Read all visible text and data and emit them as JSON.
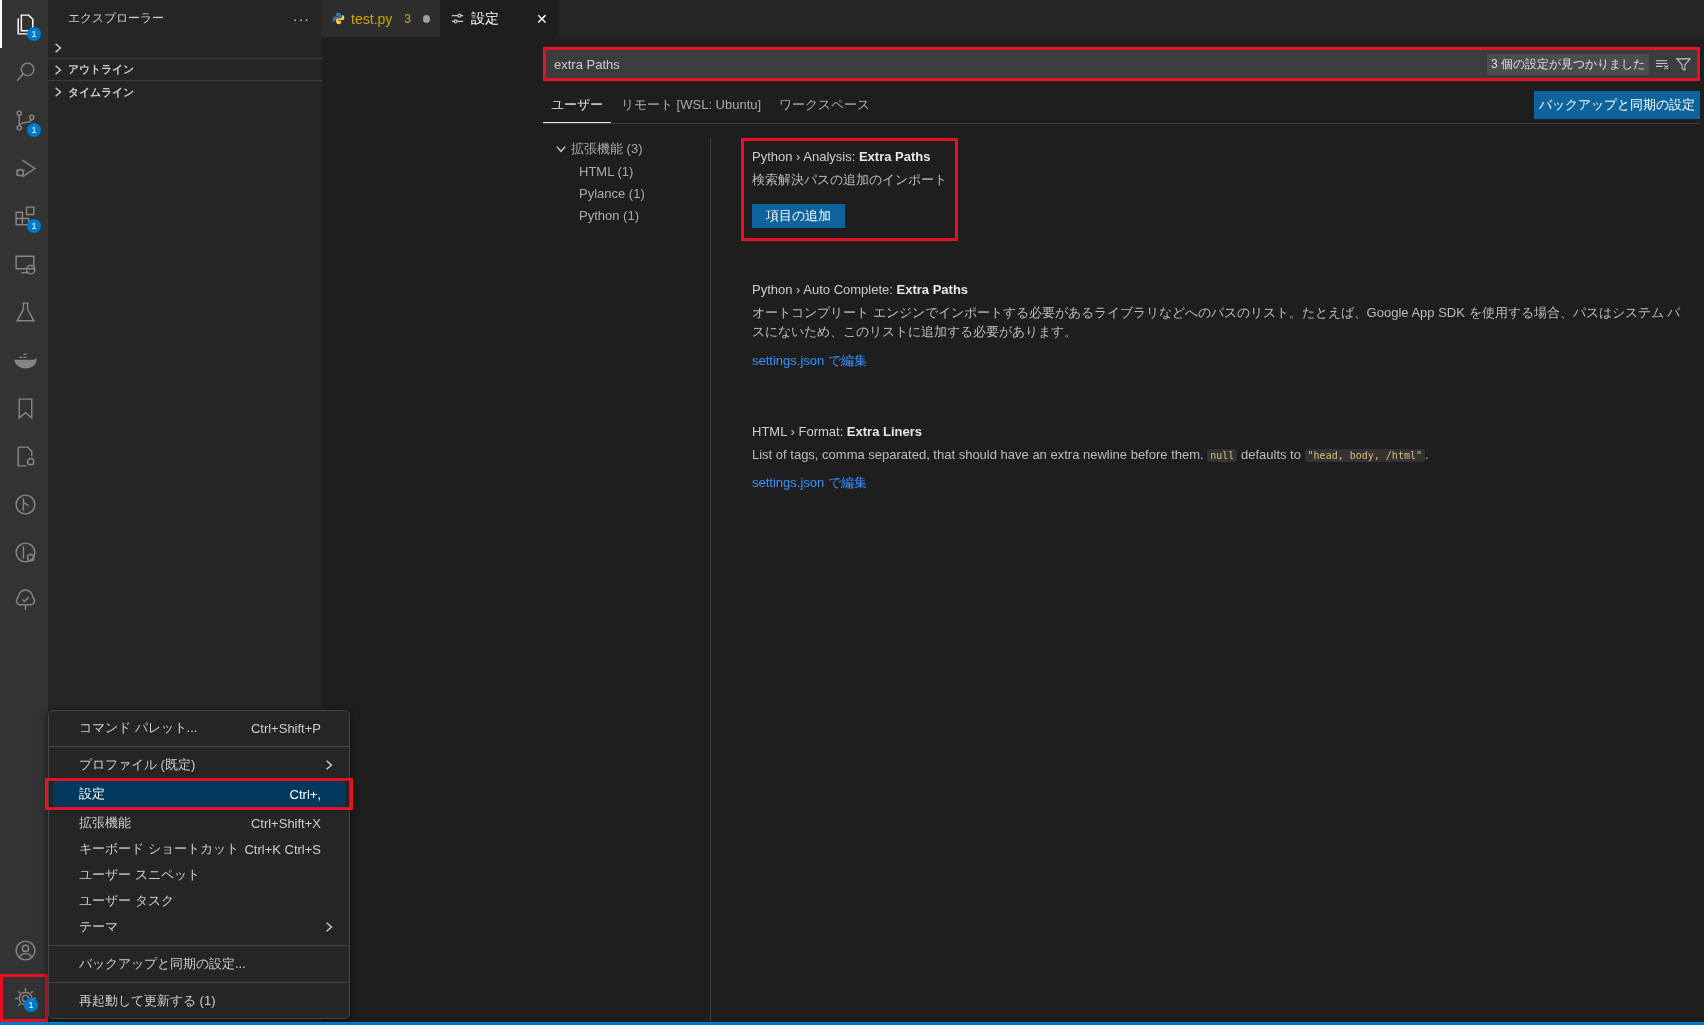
{
  "activity_bar": {
    "top": [
      {
        "kind": "files",
        "selected": true,
        "badge": "1"
      },
      {
        "kind": "search",
        "selected": false
      },
      {
        "kind": "source-control",
        "selected": false,
        "badge": "1"
      },
      {
        "kind": "run-debug",
        "selected": false
      },
      {
        "kind": "extensions",
        "selected": false,
        "badge": "1"
      },
      {
        "kind": "remote",
        "selected": false
      },
      {
        "kind": "flask",
        "selected": false
      },
      {
        "kind": "whale",
        "selected": false
      },
      {
        "kind": "bookmark",
        "selected": false
      },
      {
        "kind": "file-gear",
        "selected": false
      },
      {
        "kind": "git-graph",
        "selected": false
      },
      {
        "kind": "git-graph-search",
        "selected": false
      },
      {
        "kind": "tree-check",
        "selected": false
      }
    ],
    "bottom": [
      {
        "kind": "account",
        "selected": false
      },
      {
        "kind": "gear",
        "selected": false,
        "badge": "1",
        "highlighted": true
      }
    ]
  },
  "sidebar": {
    "title": "エクスプローラー",
    "more": "···",
    "sections": [
      {
        "expanded": false
      },
      {
        "title": "アウトライン",
        "expanded": false
      },
      {
        "title": "タイムライン",
        "expanded": false
      }
    ]
  },
  "tabs": [
    {
      "kind": "python",
      "label": "test.py",
      "problems": "3",
      "modified": true,
      "selected": false
    },
    {
      "kind": "settings",
      "label": "設定",
      "close": "✕",
      "modified": false,
      "selected": true
    }
  ],
  "settings_editor": {
    "search": {
      "value": "extra Paths",
      "highlighted": true,
      "result_count": "3 個の設定が見つかりました"
    },
    "scopes": [
      {
        "label": "ユーザー",
        "selected": true
      },
      {
        "label": "リモート [WSL: Ubuntu]",
        "selected": false
      },
      {
        "label": "ワークスペース",
        "selected": false
      }
    ],
    "sync_button": "バックアップと同期の設定",
    "toc": [
      {
        "label": "拡張機能 (3)",
        "expanded": true,
        "children": [
          {
            "label": "HTML (1)"
          },
          {
            "label": "Pylance (1)"
          },
          {
            "label": "Python (1)"
          }
        ]
      }
    ],
    "settings": [
      {
        "kind": "array",
        "category": "Python › Analysis: ",
        "title": "Extra Paths",
        "description": [
          {
            "text": "検索解決パスの追加のインポート",
            "code": false
          }
        ],
        "action": "項目の追加",
        "highlighted": true
      },
      {
        "kind": "json",
        "category": "Python › Auto Complete: ",
        "title": "Extra Paths",
        "description": [
          {
            "text": "オートコンプリート エンジンでインポートする必要があるライブラリなどへのパスのリスト。たとえば、Google App SDK を使用する場合、パスはシステム パスにないため、このリストに追加する必要があります。",
            "code": false
          }
        ],
        "action": "settings.json で編集",
        "highlighted": false
      },
      {
        "kind": "json",
        "category": "HTML › Format: ",
        "title": "Extra Liners",
        "description": [
          {
            "text": "List of tags, comma separated, that should have an extra newline before them. ",
            "code": false
          },
          {
            "text": "null",
            "code": true
          },
          {
            "text": " defaults to ",
            "code": false
          },
          {
            "text": "\"head, body, /html\"",
            "code": true
          },
          {
            "text": ".",
            "code": false
          }
        ],
        "action": "settings.json で編集",
        "highlighted": false
      }
    ]
  },
  "manage_menu": {
    "groups": [
      [
        {
          "label": "コマンド パレット...",
          "shortcut": "Ctrl+Shift+P",
          "submenu": false,
          "selected": false,
          "highlighted": false
        }
      ],
      [
        {
          "label": "プロファイル (既定)",
          "submenu": true,
          "selected": false,
          "highlighted": false
        },
        {
          "label": "設定",
          "shortcut": "Ctrl+,",
          "submenu": false,
          "selected": true,
          "highlighted": true
        },
        {
          "label": "拡張機能",
          "shortcut": "Ctrl+Shift+X",
          "submenu": false,
          "selected": false,
          "highlighted": false
        },
        {
          "label": "キーボード ショートカット",
          "shortcut": "Ctrl+K Ctrl+S",
          "submenu": false,
          "selected": false,
          "highlighted": false
        },
        {
          "label": "ユーザー スニペット",
          "submenu": false,
          "selected": false,
          "highlighted": false
        },
        {
          "label": "ユーザー タスク",
          "submenu": false,
          "selected": false,
          "highlighted": false
        },
        {
          "label": "テーマ",
          "submenu": true,
          "selected": false,
          "highlighted": false
        }
      ],
      [
        {
          "label": "バックアップと同期の設定...",
          "submenu": false,
          "selected": false,
          "highlighted": false
        }
      ],
      [
        {
          "label": "再起動して更新する (1)",
          "submenu": false,
          "selected": false,
          "highlighted": false
        }
      ]
    ]
  }
}
